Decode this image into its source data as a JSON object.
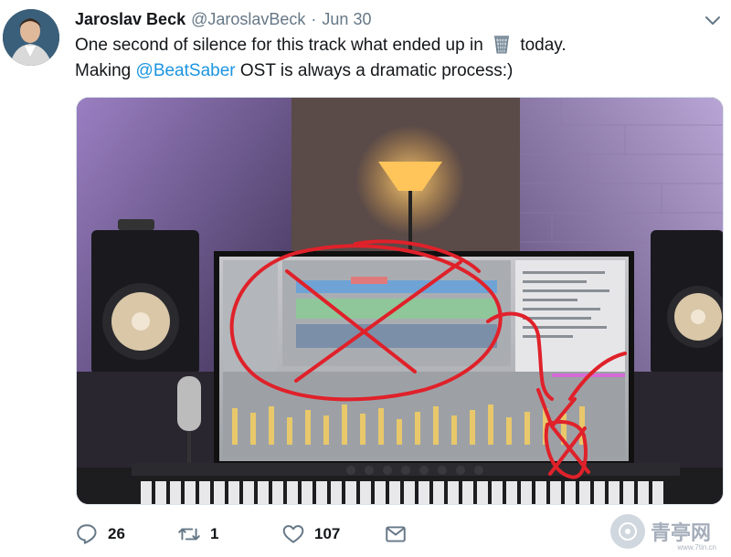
{
  "tweet": {
    "author_name": "Jaroslav Beck",
    "author_handle": "@JaroslavBeck",
    "separator": "·",
    "date": "Jun 30",
    "text_line1_before": "One second of silence for this track what ended up in",
    "text_line1_emoji": "wastebasket",
    "text_line1_after": "today.",
    "text_line2_before": "Making",
    "text_line2_mention": "@BeatSaber",
    "text_line2_after": "OST is always a dramatic process:)"
  },
  "actions": {
    "reply_count": "26",
    "retweet_count": "1",
    "like_count": "107"
  },
  "watermark": {
    "text": "青亭网",
    "url": "www.7tin.cn"
  },
  "icons": {
    "avatar": "avatar-photo",
    "menu": "chevron-down-icon",
    "reply": "reply-icon",
    "retweet": "retweet-icon",
    "like": "heart-icon",
    "dm": "envelope-icon"
  },
  "colors": {
    "link": "#1b95e0",
    "secondary": "#657786",
    "icon": "#657786"
  }
}
